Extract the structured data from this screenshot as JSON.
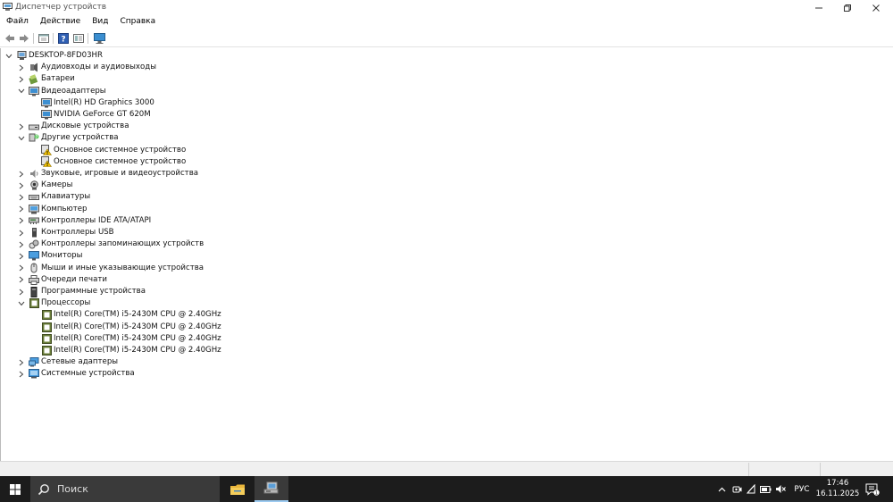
{
  "window": {
    "title": "Диспетчер устройств"
  },
  "menu": [
    {
      "label": "Файл"
    },
    {
      "label": "Действие"
    },
    {
      "label": "Вид"
    },
    {
      "label": "Справка"
    }
  ],
  "tree": {
    "root": "DESKTOP-8FD03HR",
    "items": [
      {
        "label": "Аудиовходы и аудиовыходы",
        "level": 1,
        "expanded": false,
        "icon": "audio-icon"
      },
      {
        "label": "Батареи",
        "level": 1,
        "expanded": false,
        "icon": "battery-icon"
      },
      {
        "label": "Видеоадаптеры",
        "level": 1,
        "expanded": true,
        "icon": "display-adapter-icon"
      },
      {
        "label": "Intel(R) HD Graphics 3000",
        "level": 2,
        "icon": "display-adapter-icon"
      },
      {
        "label": "NVIDIA GeForce GT 620M",
        "level": 2,
        "icon": "display-adapter-icon"
      },
      {
        "label": "Дисковые устройства",
        "level": 1,
        "expanded": false,
        "icon": "disk-drive-icon"
      },
      {
        "label": "Другие устройства",
        "level": 1,
        "expanded": true,
        "icon": "other-devices-icon"
      },
      {
        "label": "Основное системное устройство",
        "level": 2,
        "icon": "warning-device-icon"
      },
      {
        "label": "Основное системное устройство",
        "level": 2,
        "icon": "warning-device-icon"
      },
      {
        "label": "Звуковые, игровые и видеоустройства",
        "level": 1,
        "expanded": false,
        "icon": "sound-icon"
      },
      {
        "label": "Камеры",
        "level": 1,
        "expanded": false,
        "icon": "camera-icon"
      },
      {
        "label": "Клавиатуры",
        "level": 1,
        "expanded": false,
        "icon": "keyboard-icon"
      },
      {
        "label": "Компьютер",
        "level": 1,
        "expanded": false,
        "icon": "computer-icon"
      },
      {
        "label": "Контроллеры IDE ATA/ATAPI",
        "level": 1,
        "expanded": false,
        "icon": "ide-controller-icon"
      },
      {
        "label": "Контроллеры USB",
        "level": 1,
        "expanded": false,
        "icon": "usb-icon"
      },
      {
        "label": "Контроллеры запоминающих устройств",
        "level": 1,
        "expanded": false,
        "icon": "storage-controller-icon"
      },
      {
        "label": "Мониторы",
        "level": 1,
        "expanded": false,
        "icon": "monitor-icon"
      },
      {
        "label": "Мыши и иные указывающие устройства",
        "level": 1,
        "expanded": false,
        "icon": "mouse-icon"
      },
      {
        "label": "Очереди печати",
        "level": 1,
        "expanded": false,
        "icon": "printer-icon"
      },
      {
        "label": "Программные устройства",
        "level": 1,
        "expanded": false,
        "icon": "software-device-icon"
      },
      {
        "label": "Процессоры",
        "level": 1,
        "expanded": true,
        "icon": "processor-icon"
      },
      {
        "label": "Intel(R) Core(TM) i5-2430M CPU @ 2.40GHz",
        "level": 2,
        "icon": "processor-icon"
      },
      {
        "label": "Intel(R) Core(TM) i5-2430M CPU @ 2.40GHz",
        "level": 2,
        "icon": "processor-icon"
      },
      {
        "label": "Intel(R) Core(TM) i5-2430M CPU @ 2.40GHz",
        "level": 2,
        "icon": "processor-icon"
      },
      {
        "label": "Intel(R) Core(TM) i5-2430M CPU @ 2.40GHz",
        "level": 2,
        "icon": "processor-icon"
      },
      {
        "label": "Сетевые адаптеры",
        "level": 1,
        "expanded": false,
        "icon": "network-adapter-icon"
      },
      {
        "label": "Системные устройства",
        "level": 1,
        "expanded": false,
        "icon": "system-devices-icon"
      }
    ]
  },
  "taskbar": {
    "search_placeholder": "Поиск",
    "language": "РУС",
    "time": "17:46",
    "date": "16.11.2025",
    "notification_count": "1"
  },
  "colors": {
    "taskbar_bg": "#1c1c1c",
    "search_bg": "#3a3a3a",
    "accent": "#9ccaf0",
    "status_bar": "#f0f0f0"
  }
}
